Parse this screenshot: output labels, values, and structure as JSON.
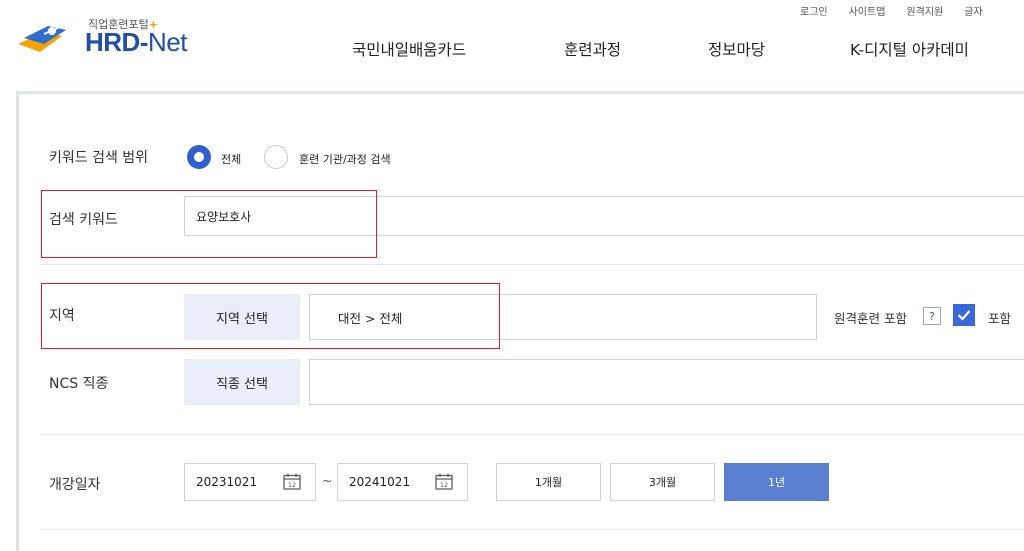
{
  "header": {
    "logo_sub": "직업훈련포털",
    "logo_plus": "+",
    "logo_main": "HRD",
    "logo_dash": "-",
    "logo_net": "Net",
    "util": [
      "로그인",
      "사이트맵",
      "원격지원",
      "글자"
    ],
    "gnb": [
      "국민내일배움카드",
      "훈련과정",
      "정보마당",
      "K-디지털 아카데미"
    ]
  },
  "search": {
    "keyword_scope_label": "키워드 검색 범위",
    "scope_all": "전체",
    "scope_institution": "훈련 기관/과정 검색",
    "keyword_label": "검색 키워드",
    "keyword_value": "요양보호사",
    "region_label": "지역",
    "region_button": "지역 선택",
    "region_value": "대전 > 전체",
    "remote_label": "원격훈련 포함",
    "help": "?",
    "include_label": "포함",
    "ncs_label": "NCS 직종",
    "ncs_button": "직종 선택",
    "date_label": "개강일자",
    "date_from": "20231021",
    "date_tilde": "~",
    "date_to": "20241021",
    "period_buttons": [
      "1개월",
      "3개월",
      "1년"
    ],
    "active_period": "1년"
  },
  "colors": {
    "brand": "#1f4fa8",
    "accent": "#2f5fd0",
    "highlight": "#e02020",
    "active_button": "#5a7fd1"
  }
}
